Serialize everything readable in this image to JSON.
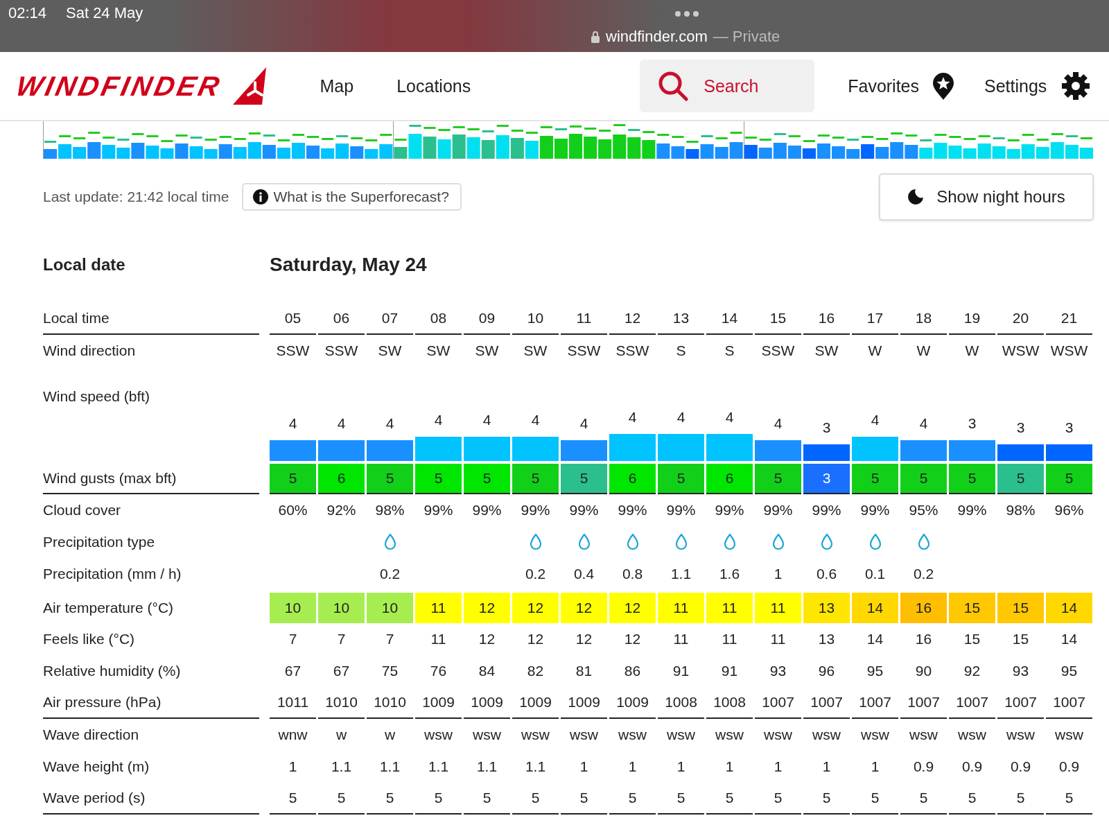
{
  "status_bar": {
    "time": "02:14",
    "date": "Sat 24 May",
    "url": "windfinder.com",
    "private": "— Private"
  },
  "nav": {
    "logo": "WINDFINDER",
    "items": [
      "Map",
      "Locations"
    ],
    "search": "Search",
    "favorites": "Favorites",
    "settings": "Settings"
  },
  "info": {
    "last_update": "Last update: 21:42 local time",
    "superforecast": "What is the Superforecast?",
    "night_button": "Show night hours"
  },
  "forecast": {
    "date_label": "Local date",
    "date": "Saturday, May 24",
    "sections": [
      {
        "rows": [
          {
            "kind": "text",
            "label": "Local time",
            "values": [
              "05",
              "06",
              "07",
              "08",
              "09",
              "10",
              "11",
              "12",
              "13",
              "14",
              "15",
              "16",
              "17",
              "18",
              "19",
              "20",
              "21"
            ]
          }
        ]
      },
      {
        "rows": [
          {
            "kind": "text",
            "label": "Wind direction",
            "values": [
              "SSW",
              "SSW",
              "SW",
              "SW",
              "SW",
              "SW",
              "SSW",
              "SSW",
              "S",
              "S",
              "SSW",
              "SW",
              "W",
              "W",
              "W",
              "WSW",
              "WSW"
            ]
          },
          {
            "kind": "bars",
            "label": "Wind speed (bft)",
            "cells": [
              {
                "value": "4",
                "color": "#1a90ff"
              },
              {
                "value": "4",
                "color": "#1a90ff"
              },
              {
                "value": "4",
                "color": "#1a90ff"
              },
              {
                "value": "4",
                "color": "#00c3ff"
              },
              {
                "value": "4",
                "color": "#00c3ff"
              },
              {
                "value": "4",
                "color": "#00c3ff"
              },
              {
                "value": "4",
                "color": "#1a90ff"
              },
              {
                "value": "4",
                "color": "#00c3ff"
              },
              {
                "value": "4",
                "color": "#00c3ff"
              },
              {
                "value": "4",
                "color": "#00c3ff"
              },
              {
                "value": "4",
                "color": "#1a90ff"
              },
              {
                "value": "3",
                "color": "#0066ff"
              },
              {
                "value": "4",
                "color": "#00c3ff"
              },
              {
                "value": "4",
                "color": "#1a90ff"
              },
              {
                "value": "3",
                "color": "#1a90ff"
              },
              {
                "value": "3",
                "color": "#0066ff"
              },
              {
                "value": "3",
                "color": "#0066ff"
              }
            ]
          },
          {
            "kind": "colored",
            "label": "Wind gusts (max bft)",
            "cells": [
              {
                "value": "5",
                "color": "#12d01a"
              },
              {
                "value": "6",
                "color": "#00e600"
              },
              {
                "value": "5",
                "color": "#12d01a"
              },
              {
                "value": "5",
                "color": "#00e600"
              },
              {
                "value": "5",
                "color": "#00e600"
              },
              {
                "value": "5",
                "color": "#12d01a"
              },
              {
                "value": "5",
                "color": "#2bbf8e"
              },
              {
                "value": "6",
                "color": "#00e600"
              },
              {
                "value": "5",
                "color": "#12d01a"
              },
              {
                "value": "6",
                "color": "#00e600"
              },
              {
                "value": "5",
                "color": "#12d01a"
              },
              {
                "value": "3",
                "color": "#1a6fff"
              },
              {
                "value": "5",
                "color": "#12d01a"
              },
              {
                "value": "5",
                "color": "#12d01a"
              },
              {
                "value": "5",
                "color": "#12d01a"
              },
              {
                "value": "5",
                "color": "#2bbf8e"
              },
              {
                "value": "5",
                "color": "#12d01a"
              }
            ]
          }
        ]
      },
      {
        "rows": [
          {
            "kind": "text",
            "label": "Cloud cover",
            "values": [
              "60%",
              "92%",
              "98%",
              "99%",
              "99%",
              "99%",
              "99%",
              "99%",
              "99%",
              "99%",
              "99%",
              "99%",
              "99%",
              "95%",
              "99%",
              "98%",
              "96%"
            ]
          },
          {
            "kind": "icons",
            "label": "Precipitation type",
            "rain": [
              false,
              false,
              true,
              false,
              false,
              true,
              true,
              true,
              true,
              true,
              true,
              true,
              true,
              true,
              false,
              false,
              false
            ]
          },
          {
            "kind": "sparse",
            "label": "Precipitation (mm / h)",
            "cells": [
              {},
              {},
              {
                "value": "0.2"
              },
              {},
              {},
              {
                "value": "0.2"
              },
              {
                "value": "0.4"
              },
              {
                "value": "0.8"
              },
              {
                "value": "1.1"
              },
              {
                "value": "1.6"
              },
              {
                "value": "1"
              },
              {
                "value": "0.6"
              },
              {
                "value": "0.1"
              },
              {
                "value": "0.2"
              },
              {},
              {},
              {}
            ]
          },
          {
            "kind": "colored",
            "label": "Air temperature (°C)",
            "cells": [
              {
                "value": "10",
                "color": "#a6ee50"
              },
              {
                "value": "10",
                "color": "#a6ee50"
              },
              {
                "value": "10",
                "color": "#a6ee50"
              },
              {
                "value": "11",
                "color": "#ffff00"
              },
              {
                "value": "12",
                "color": "#ffff00"
              },
              {
                "value": "12",
                "color": "#ffff00"
              },
              {
                "value": "12",
                "color": "#ffff00"
              },
              {
                "value": "12",
                "color": "#ffff00"
              },
              {
                "value": "11",
                "color": "#ffff00"
              },
              {
                "value": "11",
                "color": "#ffff00"
              },
              {
                "value": "11",
                "color": "#ffff00"
              },
              {
                "value": "13",
                "color": "#ffe600"
              },
              {
                "value": "14",
                "color": "#ffd800"
              },
              {
                "value": "16",
                "color": "#ffbe00"
              },
              {
                "value": "15",
                "color": "#ffc800"
              },
              {
                "value": "15",
                "color": "#ffc800"
              },
              {
                "value": "14",
                "color": "#ffd800"
              }
            ]
          },
          {
            "kind": "text",
            "label": "Feels like (°C)",
            "values": [
              "7",
              "7",
              "7",
              "11",
              "12",
              "12",
              "12",
              "12",
              "11",
              "11",
              "11",
              "13",
              "14",
              "16",
              "15",
              "15",
              "14"
            ]
          },
          {
            "kind": "text",
            "label": "Relative humidity (%)",
            "values": [
              "67",
              "67",
              "75",
              "76",
              "84",
              "82",
              "81",
              "86",
              "91",
              "91",
              "93",
              "96",
              "95",
              "90",
              "92",
              "93",
              "95"
            ]
          },
          {
            "kind": "text",
            "label": "Air pressure (hPa)",
            "values": [
              "1011",
              "1010",
              "1010",
              "1009",
              "1009",
              "1009",
              "1009",
              "1009",
              "1008",
              "1008",
              "1007",
              "1007",
              "1007",
              "1007",
              "1007",
              "1007",
              "1007"
            ]
          }
        ]
      },
      {
        "rows": [
          {
            "kind": "text",
            "label": "Wave direction",
            "values": [
              "wnw",
              "w",
              "w",
              "wsw",
              "wsw",
              "wsw",
              "wsw",
              "wsw",
              "wsw",
              "wsw",
              "wsw",
              "wsw",
              "wsw",
              "wsw",
              "wsw",
              "wsw",
              "wsw"
            ]
          },
          {
            "kind": "text",
            "label": "Wave height (m)",
            "values": [
              "1",
              "1.1",
              "1.1",
              "1.1",
              "1.1",
              "1.1",
              "1",
              "1",
              "1",
              "1",
              "1",
              "1",
              "1",
              "0.9",
              "0.9",
              "0.9",
              "0.9"
            ]
          },
          {
            "kind": "text",
            "label": "Wave period (s)",
            "values": [
              "5",
              "5",
              "5",
              "5",
              "5",
              "5",
              "5",
              "5",
              "5",
              "5",
              "5",
              "5",
              "5",
              "5",
              "5",
              "5",
              "5"
            ]
          }
        ]
      }
    ]
  }
}
